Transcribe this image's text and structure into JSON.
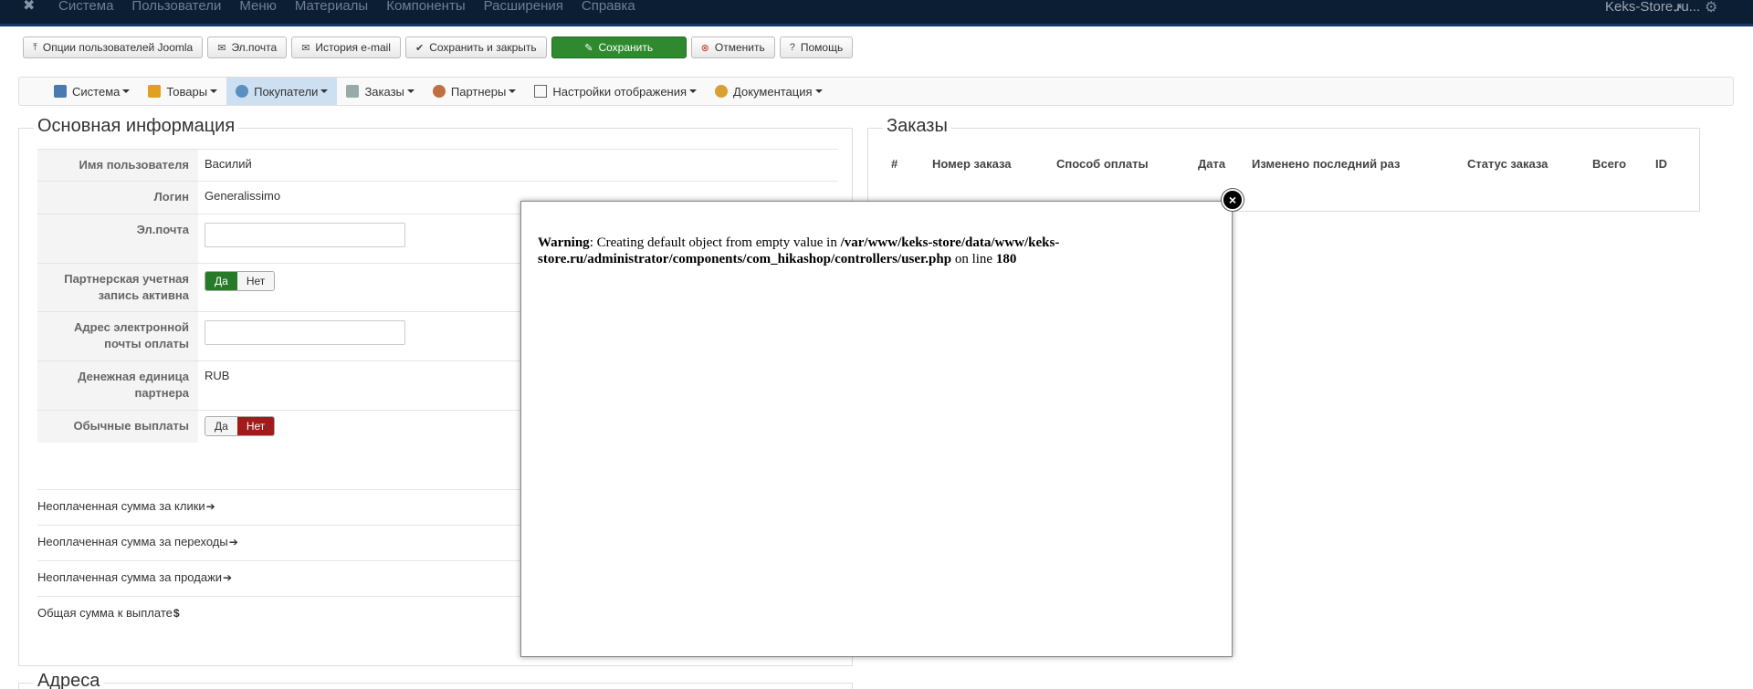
{
  "topnav": {
    "menu": [
      "Система",
      "Пользователи",
      "Меню",
      "Материалы",
      "Компоненты",
      "Расширения",
      "Справка"
    ],
    "site_name": "Keks-Store.ru..."
  },
  "toolbar": {
    "options_label": "Опции пользователей Joomla",
    "email_label": "Эл.почта",
    "email_history_label": "История e-mail",
    "save_close_label": "Сохранить и закрыть",
    "save_label": "Сохранить",
    "cancel_label": "Отменить",
    "help_label": "Помощь"
  },
  "submenu": {
    "items": [
      "Система",
      "Товары",
      "Покупатели",
      "Заказы",
      "Партнеры",
      "Настройки отображения",
      "Документация"
    ],
    "active": "Покупатели"
  },
  "main_info": {
    "legend": "Основная информация",
    "rows": {
      "username_label": "Имя пользователя",
      "username_value": "Василий",
      "login_label": "Логин",
      "login_value": "Generalissimo",
      "email_label": "Эл.почта",
      "partner_active_label": "Партнерская учетная запись активна",
      "payment_email_label": "Адрес электронной почты оплаты",
      "currency_label": "Денежная единица партнера",
      "currency_value": "RUB",
      "regular_payouts_label": "Обычные выплаты"
    },
    "toggle_yes": "Да",
    "toggle_no": "Нет",
    "sums": {
      "clicks": "Неоплаченная сумма за клики",
      "leads": "Неоплаченная сумма за переходы",
      "sales": "Неоплаченная сумма за продажи",
      "total": "Общая сумма к выплате"
    }
  },
  "addresses": {
    "legend": "Адреса"
  },
  "orders": {
    "legend": "Заказы",
    "columns": [
      "#",
      "Номер заказа",
      "Способ оплаты",
      "Дата",
      "Изменено последний раз",
      "Статус заказа",
      "Всего",
      "ID"
    ]
  },
  "modal": {
    "warning_label": "Warning",
    "message_text": ": Creating default object from empty value in ",
    "path": "/var/www/keks-store/data/www/keks-store.ru/administrator/components/com_hikashop/controllers/user.php",
    "on_line_text": " on line ",
    "line_number": "180"
  }
}
